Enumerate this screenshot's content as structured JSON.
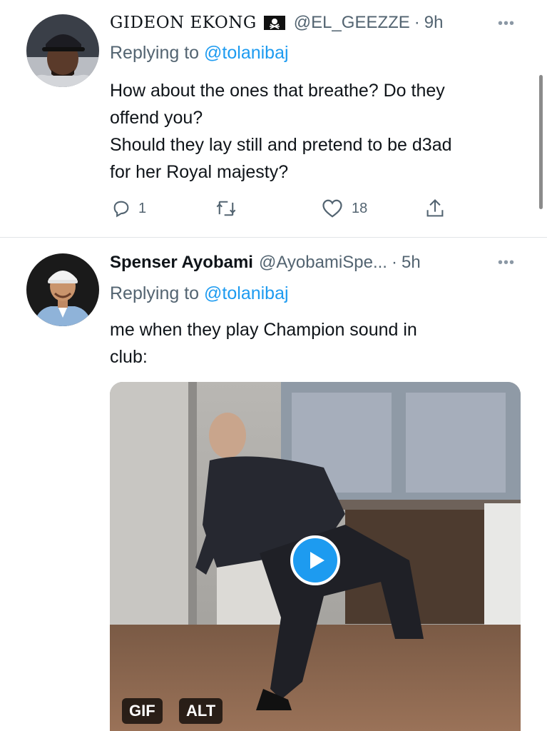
{
  "tweets": [
    {
      "name": "GIDEON EKONG",
      "flag_icon": "pirate-flag-icon",
      "handle": "@EL_GEEZZE",
      "separator": "·",
      "time": "9h",
      "replying_prefix": "Replying to",
      "replying_to": "@tolanibaj",
      "lines": [
        "How about the ones that breathe? Do they",
        "offend you?",
        "Should they lay still and pretend to be d3ad",
        "for her Royal majesty?"
      ],
      "reply_count": "1",
      "like_count": "18"
    },
    {
      "name": "Spenser Ayobami",
      "handle": "@AyobamiSpe...",
      "separator": "·",
      "time": "5h",
      "replying_prefix": "Replying to",
      "replying_to": "@tolanibaj",
      "lines": [
        "me when they play Champion sound in",
        "club:"
      ],
      "media": {
        "gif_badge": "GIF",
        "alt_badge": "ALT",
        "play_icon": "play-icon"
      }
    }
  ],
  "colors": {
    "accent": "#1d9bf0",
    "secondary_text": "#536471",
    "primary_text": "#0f1419"
  }
}
